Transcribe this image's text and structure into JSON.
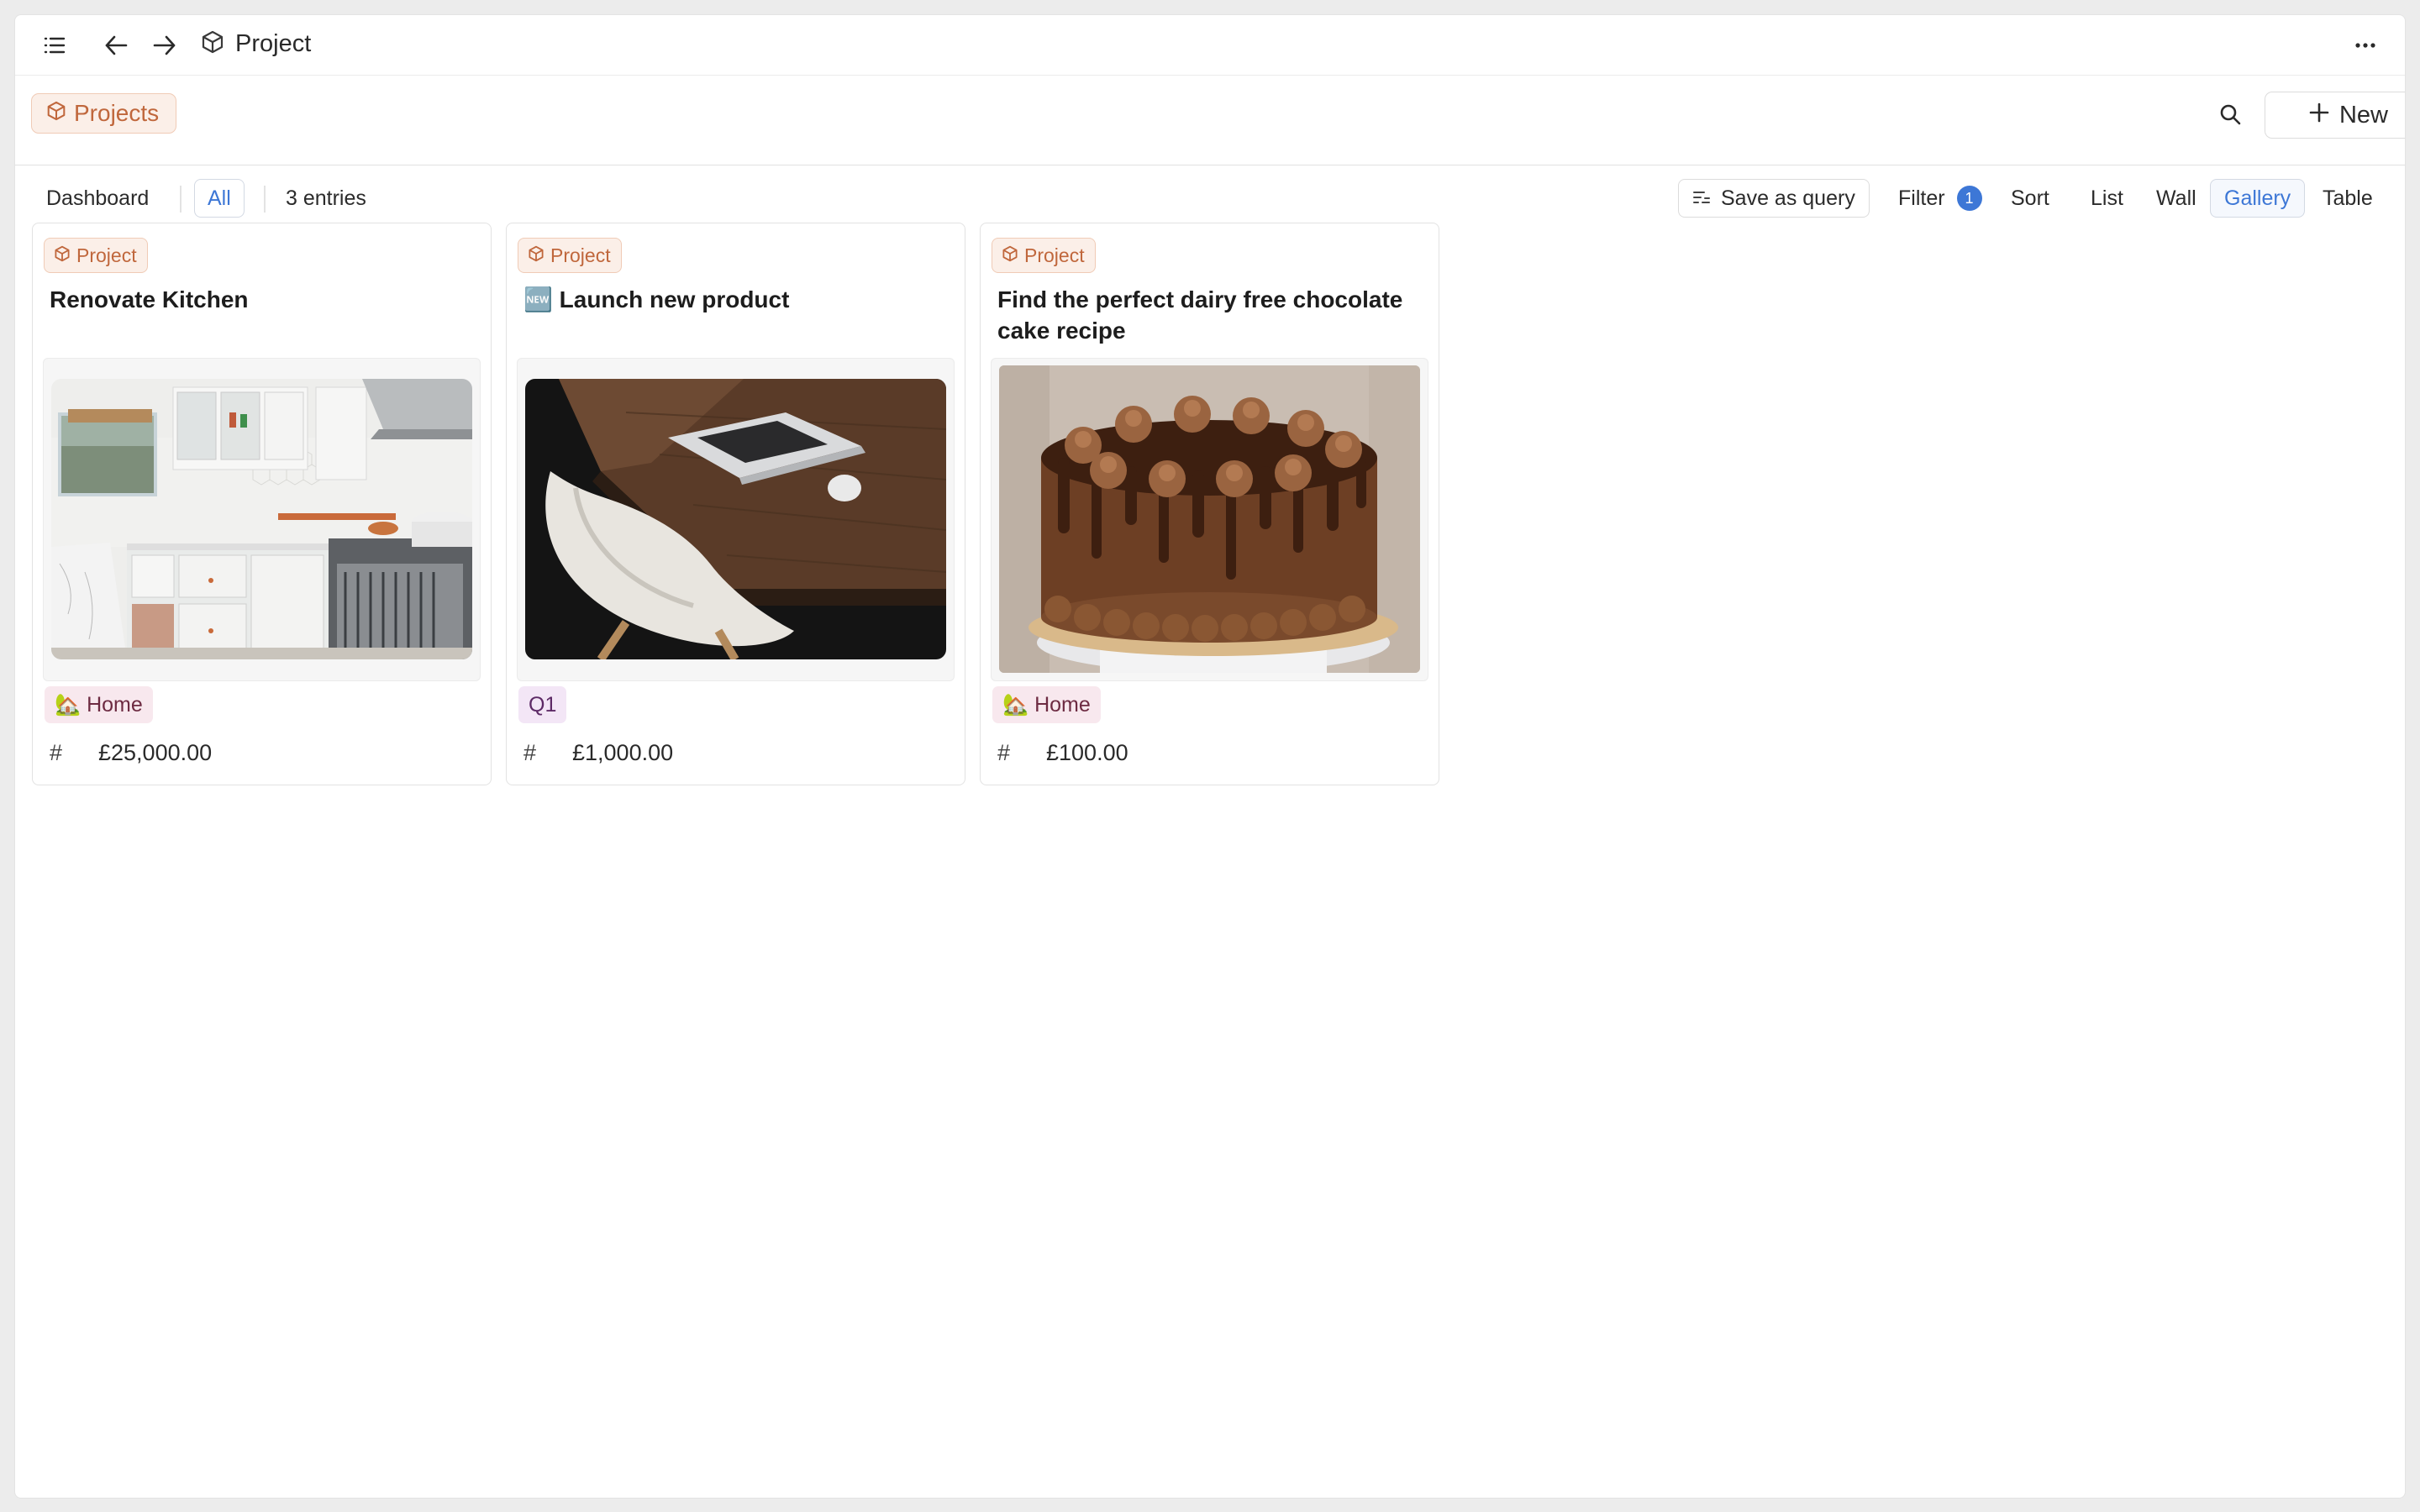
{
  "topbar": {
    "title": "Project",
    "icons": {
      "sidebar": "sidebar-toggle-icon",
      "back": "arrow-left-icon",
      "forward": "arrow-right-icon",
      "more": "more-dots-icon",
      "cube": "cube-icon"
    }
  },
  "header": {
    "collection_tag": "Projects",
    "new_label": "New"
  },
  "toolbar": {
    "dashboard": "Dashboard",
    "all": "All",
    "entries": "3 entries",
    "save_as_query": "Save as query",
    "filter": "Filter",
    "filter_count": "1",
    "sort": "Sort",
    "list": "List",
    "wall": "Wall",
    "gallery": "Gallery",
    "table": "Table",
    "active_view": "Gallery"
  },
  "cards": [
    {
      "tag": "Project",
      "title": "Renovate Kitchen",
      "image": "kitchen-photo",
      "chip": "🏡 Home",
      "amount": "£25,000.00"
    },
    {
      "tag": "Project",
      "title": "🆕 Launch new product",
      "image": "laptop-desk-photo",
      "chip": "Q1",
      "amount": "£1,000.00"
    },
    {
      "tag": "Project",
      "title": "Find the perfect dairy free chocolate cake recipe",
      "image": "chocolate-cake-photo",
      "chip": "🏡 Home",
      "amount": "£100.00"
    }
  ],
  "colors": {
    "accent": "#3d77d6",
    "project_tag_bg": "#fbefe8",
    "project_tag_text": "#c0673c",
    "home_chip_bg": "#f8e8ee",
    "q1_chip_bg": "#f3e6f6"
  }
}
